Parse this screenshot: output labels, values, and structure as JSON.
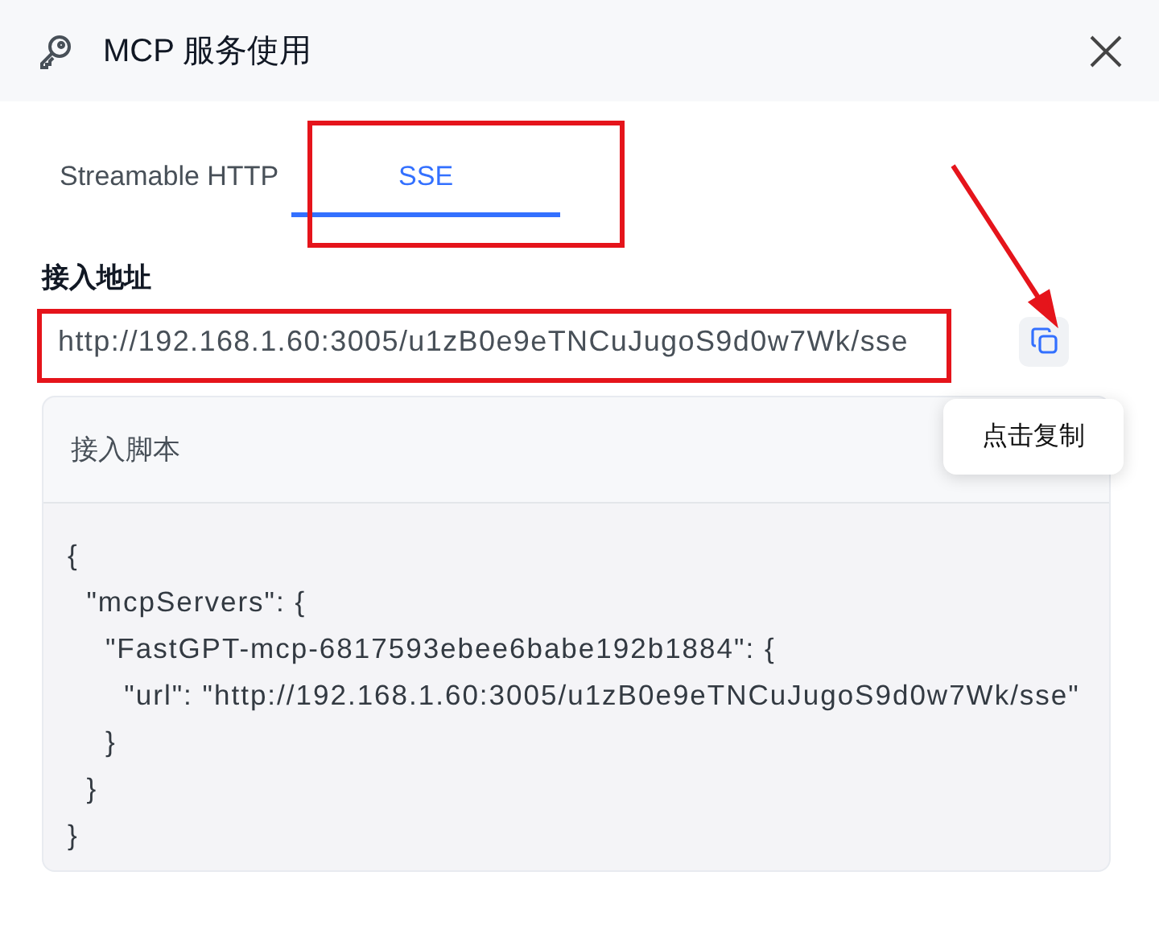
{
  "dialog": {
    "title": "MCP 服务使用"
  },
  "tabs": [
    {
      "label": "Streamable HTTP",
      "selected": false
    },
    {
      "label": "SSE",
      "selected": true
    }
  ],
  "address": {
    "label": "接入地址",
    "value": "http://192.168.1.60:3005/u1zB0e9eTNCuJugoS9d0w7Wk/sse"
  },
  "tooltip": "点击复制",
  "script": {
    "title": "接入脚本",
    "code": "{\n  \"mcpServers\": {\n    \"FastGPT-mcp-6817593ebee6babe192b1884\": {\n      \"url\": \"http://192.168.1.60:3005/u1zB0e9eTNCuJugoS9d0w7Wk/sse\"\n    }\n  }\n}"
  }
}
